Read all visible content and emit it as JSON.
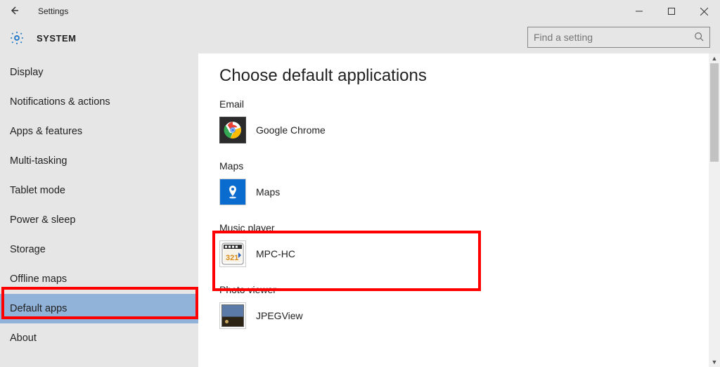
{
  "window": {
    "title": "Settings"
  },
  "header": {
    "section": "SYSTEM",
    "search_placeholder": "Find a setting"
  },
  "sidebar": {
    "items": [
      {
        "label": "Display"
      },
      {
        "label": "Notifications & actions"
      },
      {
        "label": "Apps & features"
      },
      {
        "label": "Multi-tasking"
      },
      {
        "label": "Tablet mode"
      },
      {
        "label": "Power & sleep"
      },
      {
        "label": "Storage"
      },
      {
        "label": "Offline maps"
      },
      {
        "label": "Default apps",
        "selected": true
      },
      {
        "label": "About"
      }
    ]
  },
  "content": {
    "heading": "Choose default applications",
    "categories": [
      {
        "label": "Email",
        "app": "Google Chrome",
        "icon": "chrome"
      },
      {
        "label": "Maps",
        "app": "Maps",
        "icon": "maps"
      },
      {
        "label": "Music player",
        "app": "MPC-HC",
        "icon": "mpc"
      },
      {
        "label": "Photo viewer",
        "app": "JPEGView",
        "icon": "jpeg"
      }
    ]
  }
}
